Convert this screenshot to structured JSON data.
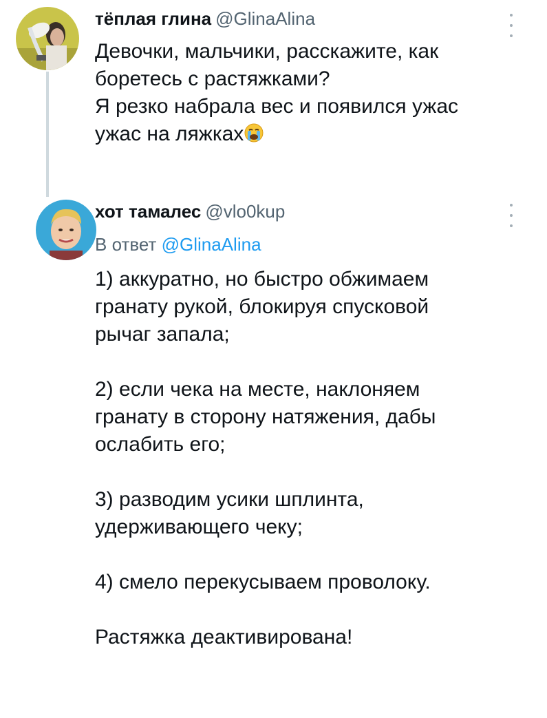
{
  "tweets": [
    {
      "author_name": "тёплая глина",
      "author_handle": "@GlinaAlina",
      "lines": [
        "Девочки, мальчики, расскажите, как",
        "боретесь с растяжками?",
        "Я резко набрала вес и появился ужас",
        "ужас на ляжках"
      ],
      "emoji": "crying-face"
    },
    {
      "author_name": "хот тамалес",
      "author_handle": "@vlo0kup",
      "reply_prefix": "В ответ",
      "reply_to": "@GlinaAlina",
      "paragraphs": [
        [
          "1) аккуратно, но быстро обжимаем",
          "гранату рукой, блокируя спусковой",
          "рычаг запала;"
        ],
        [
          "2) если чека на месте, наклоняем",
          "гранату в сторону натяжения, дабы",
          "ослабить его;"
        ],
        [
          "3) разводим усики шплинта,",
          "удерживающего чеку;"
        ],
        [
          "4) смело перекусываем проволоку."
        ],
        [
          "Растяжка деактивирована!"
        ]
      ]
    }
  ],
  "colors": {
    "text": "#0f1419",
    "secondary": "#536471",
    "link": "#1d9bf0",
    "thread_line": "#cfd9de"
  }
}
